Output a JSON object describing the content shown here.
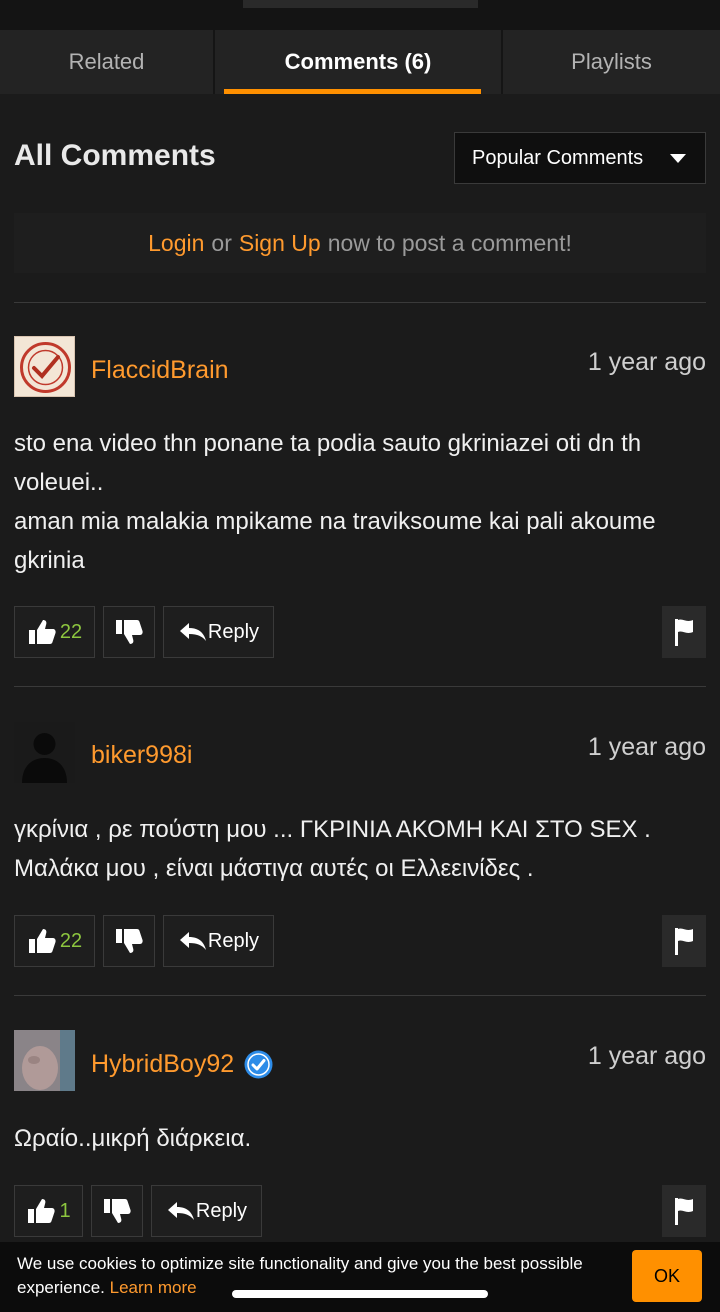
{
  "tabs": [
    {
      "label": "Related",
      "active": false
    },
    {
      "label": "Comments (6)",
      "active": true
    },
    {
      "label": "Playlists",
      "active": false
    }
  ],
  "section": {
    "title": "All Comments",
    "sort_selected": "Popular Comments"
  },
  "login_prompt": {
    "login": "Login",
    "or": "or",
    "signup": "Sign Up",
    "rest": "now to post a comment!"
  },
  "comments": [
    {
      "username": "FlaccidBrain",
      "time": "1 year ago",
      "text": "sto ena video thn ponane ta podia sauto gkriniazei oti dn th voleuei..\naman mia malakia mpikame na traviksoume kai pali akoume gkrinia",
      "likes": "22",
      "reply_label": "Reply",
      "verified": false,
      "avatar_icon": "checked-stamp-avatar"
    },
    {
      "username": "biker998i",
      "time": "1 year ago",
      "text": "γκρίνια , ρε πούστη μου ... ΓΚΡΙΝΙΑ ΑΚΟΜΗ ΚΑΙ ΣΤΟ SEX . Μαλάκα μου , είναι μάστιγα αυτές οι Ελλεεινίδες .",
      "likes": "22",
      "reply_label": "Reply",
      "verified": false,
      "avatar_icon": "default-user-silhouette"
    },
    {
      "username": "HybridBoy92",
      "time": "1 year ago",
      "text": "Ωραίο..μικρή διάρκεια.",
      "likes": "1",
      "reply_label": "Reply",
      "verified": true,
      "avatar_icon": "user-photo-avatar"
    }
  ],
  "cookie_banner": {
    "message": "We use cookies to optimize site functionality and give you the best possible experience.",
    "learn_more": "Learn more",
    "ok_label": "OK"
  },
  "colors": {
    "accent": "#ff9000",
    "username": "#ff9a2e",
    "like_count": "#8dc63f",
    "background": "#1b1b1b"
  }
}
